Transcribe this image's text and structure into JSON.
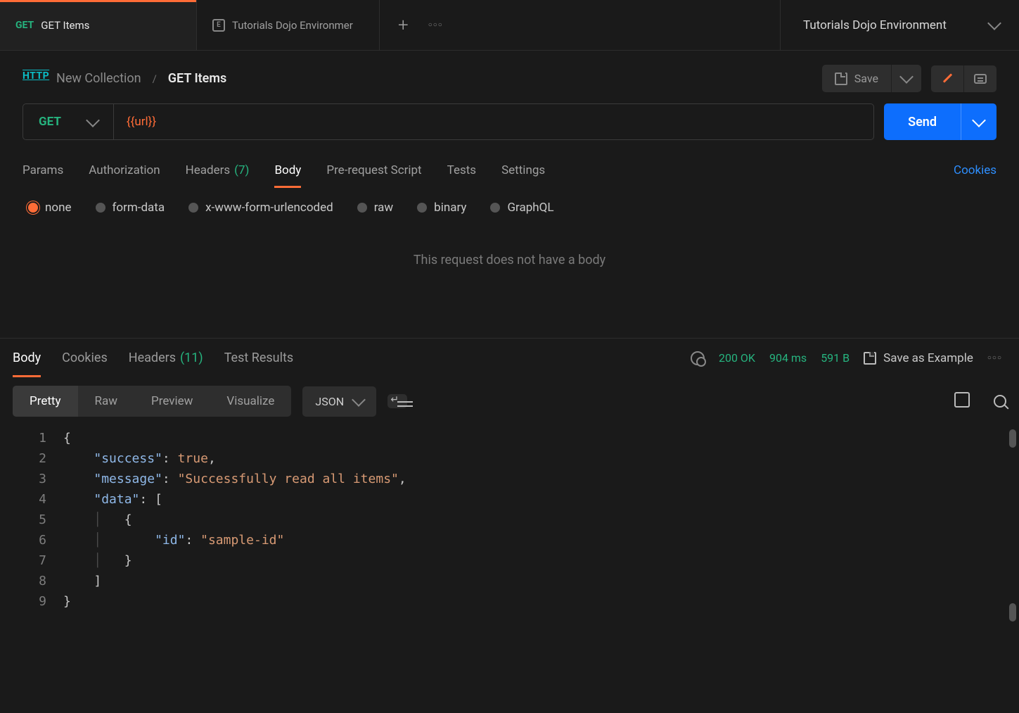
{
  "tabs": {
    "items": [
      {
        "method": "GET",
        "label": "GET Items",
        "active": true
      },
      {
        "icon": "env",
        "label": "Tutorials Dojo Environmer",
        "active": false
      }
    ]
  },
  "env_selector": {
    "label": "Tutorials Dojo Environment"
  },
  "breadcrumb": {
    "collection": "New Collection",
    "separator": "/",
    "request": "GET Items",
    "save_label": "Save"
  },
  "request": {
    "method": "GET",
    "url": "{{url}}",
    "send_label": "Send",
    "tabs": {
      "params": "Params",
      "auth": "Authorization",
      "headers_label": "Headers",
      "headers_count": "(7)",
      "body": "Body",
      "prereq": "Pre-request Script",
      "tests": "Tests",
      "settings": "Settings"
    },
    "cookies_link": "Cookies",
    "body_types": {
      "none": "none",
      "formdata": "form-data",
      "xwww": "x-www-form-urlencoded",
      "raw": "raw",
      "binary": "binary",
      "graphql": "GraphQL"
    },
    "body_empty_msg": "This request does not have a body"
  },
  "response": {
    "tabs": {
      "body": "Body",
      "cookies": "Cookies",
      "headers_label": "Headers",
      "headers_count": "(11)",
      "test_results": "Test Results"
    },
    "status": "200 OK",
    "time": "904 ms",
    "size": "591 B",
    "save_example": "Save as Example",
    "views": {
      "pretty": "Pretty",
      "raw": "Raw",
      "preview": "Preview",
      "visualize": "Visualize"
    },
    "format": "JSON",
    "code": {
      "lines": [
        "1",
        "2",
        "3",
        "4",
        "5",
        "6",
        "7",
        "8",
        "9"
      ],
      "l2_key": "\"success\"",
      "l2_val": "true",
      "l3_key": "\"message\"",
      "l3_val": "\"Successfully read all items\"",
      "l4_key": "\"data\"",
      "l6_key": "\"id\"",
      "l6_val": "\"sample-id\""
    }
  }
}
